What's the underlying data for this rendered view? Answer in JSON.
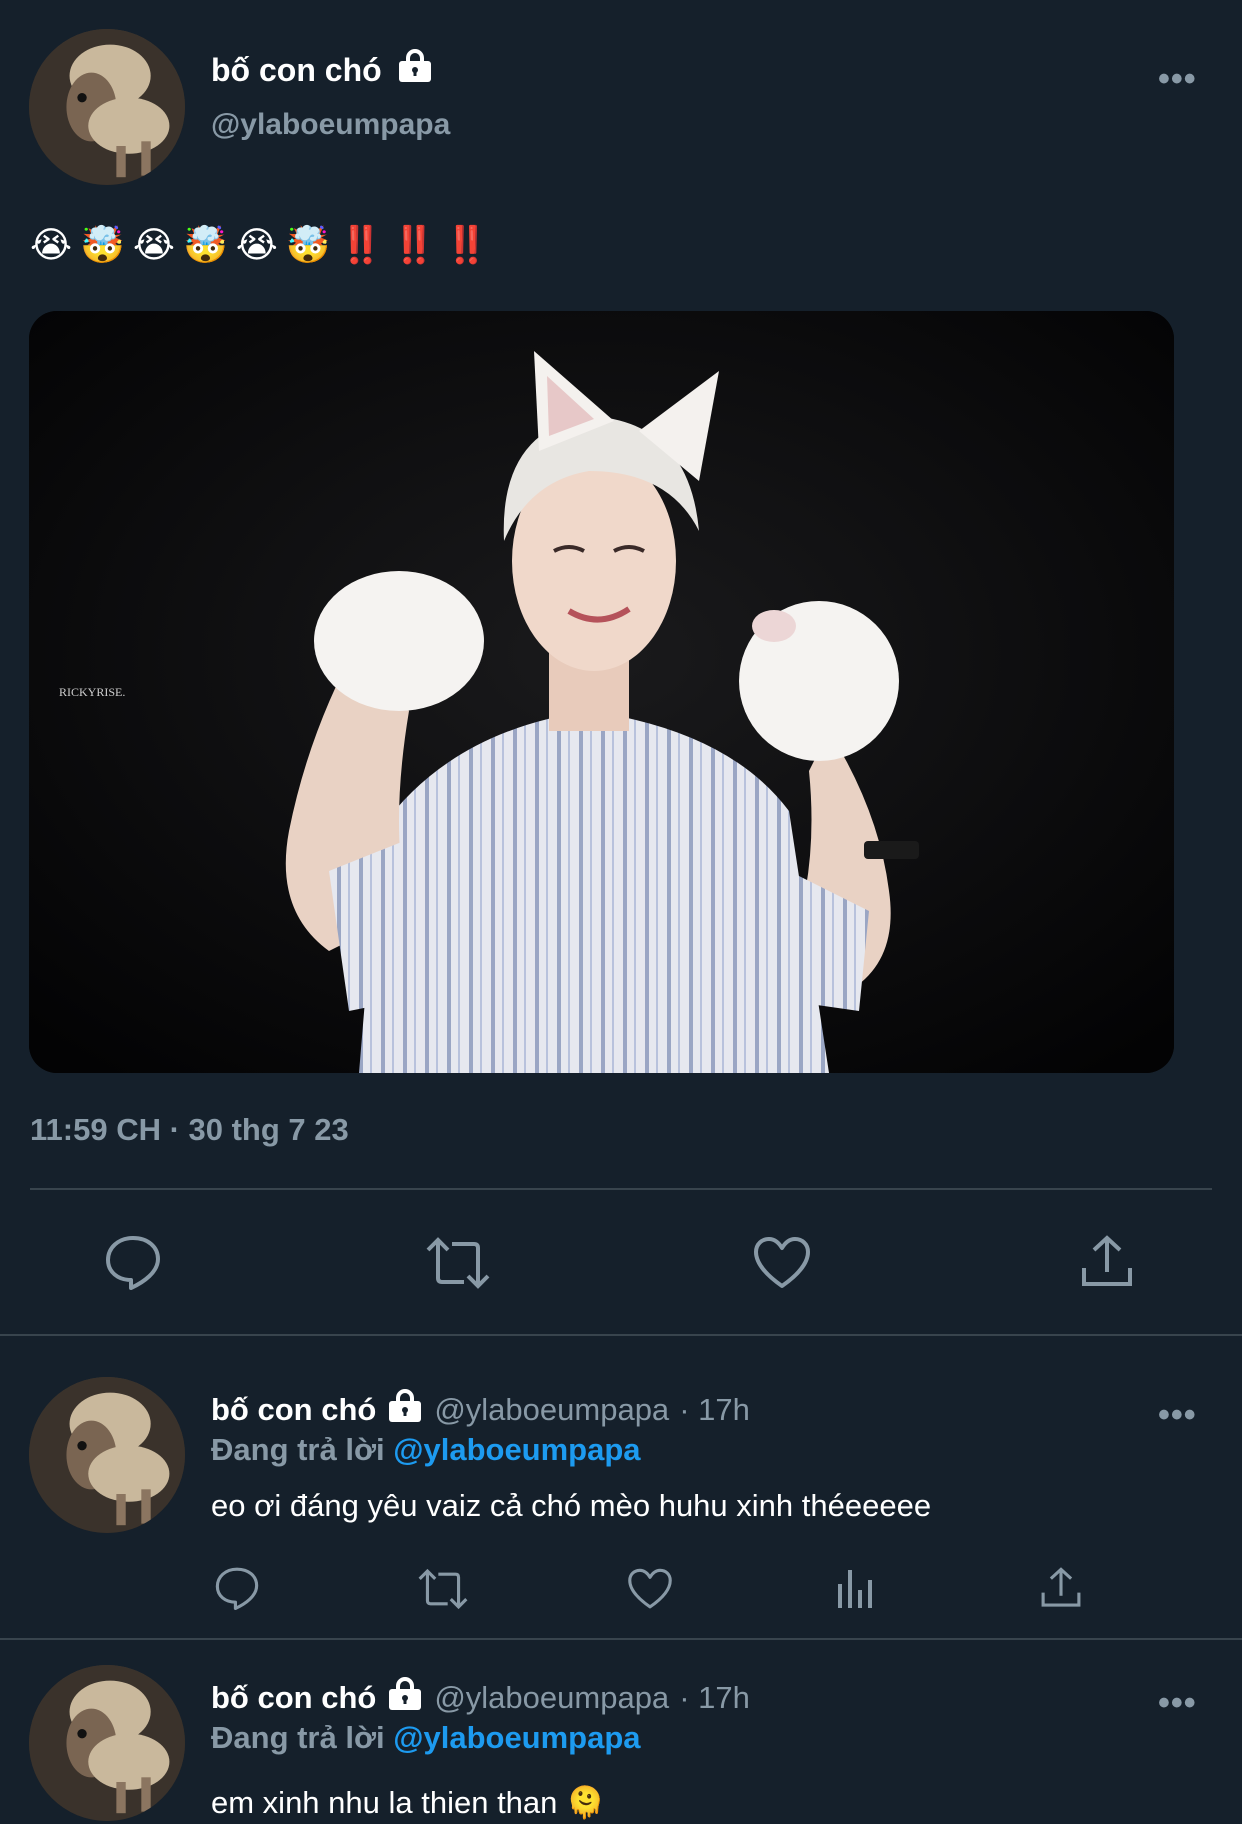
{
  "main_tweet": {
    "display_name": "bố con chó",
    "handle": "@ylaboeumpapa",
    "text": "😭🤯😭🤯😭🤯‼️‼️‼️",
    "image_watermark": "RICKYRISE.",
    "timestamp": "11:59 CH · 30 thg 7 23"
  },
  "replies": [
    {
      "display_name": "bố con chó",
      "handle": "@ylaboeumpapa",
      "time": "· 17h",
      "replying_label": "Đang trả lời",
      "replying_to": "@ylaboeumpapa",
      "text": "eo ơi đáng yêu vaiz cả chó mèo huhu xinh théeeeee"
    },
    {
      "display_name": "bố con chó",
      "handle": "@ylaboeumpapa",
      "time": "· 17h",
      "replying_label": "Đang trả lời",
      "replying_to": "@ylaboeumpapa",
      "text": "em xinh nhu la thien than 🫠"
    }
  ],
  "icons": {
    "reply": "speech-bubble-icon",
    "retweet": "retweet-icon",
    "like": "heart-icon",
    "share": "share-icon",
    "views": "bar-chart-icon",
    "more": "more-dots-icon",
    "protected": "lock-icon"
  },
  "colors": {
    "background": "#15202b",
    "secondary_text": "#8899a6",
    "accent": "#1d9bf0",
    "divider": "#38444d"
  }
}
